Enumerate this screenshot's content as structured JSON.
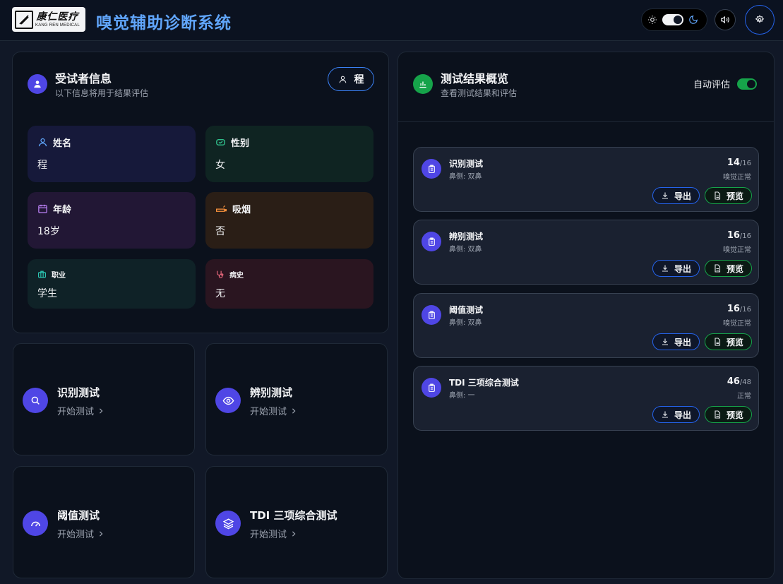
{
  "header": {
    "logo_cn": "康仁医疗",
    "logo_en": "KANG REN MEDICAL",
    "title": "嗅觉辅助诊断系统"
  },
  "subject": {
    "title": "受试者信息",
    "subtitle": "以下信息将用于结果评估",
    "user_name": "程",
    "fields": {
      "name": {
        "label": "姓名",
        "value": "程"
      },
      "gender": {
        "label": "性别",
        "value": "女"
      },
      "age": {
        "label": "年龄",
        "value": "18岁"
      },
      "smoking": {
        "label": "吸烟",
        "value": "否"
      },
      "occupation": {
        "label": "职业",
        "value": "学生"
      },
      "history": {
        "label": "病史",
        "value": "无"
      }
    }
  },
  "tests": [
    {
      "title": "识别测试",
      "action": "开始测试"
    },
    {
      "title": "辨别测试",
      "action": "开始测试"
    },
    {
      "title": "阈值测试",
      "action": "开始测试"
    },
    {
      "title": "TDI 三项综合测试",
      "action": "开始测试"
    }
  ],
  "results": {
    "title": "测试结果概览",
    "subtitle": "查看测试结果和评估",
    "auto_eval_label": "自动评估",
    "auto_eval_on": true,
    "export_label": "导出",
    "preview_label": "预览",
    "items": [
      {
        "title": "识别测试",
        "side": "鼻侧: 双鼻",
        "score": "14",
        "total": "/16",
        "status": "嗅觉正常"
      },
      {
        "title": "辨别测试",
        "side": "鼻侧: 双鼻",
        "score": "16",
        "total": "/16",
        "status": "嗅觉正常"
      },
      {
        "title": "阈值测试",
        "side": "鼻侧: 双鼻",
        "score": "16",
        "total": "/16",
        "status": "嗅觉正常"
      },
      {
        "title": "TDI 三项综合测试",
        "side": "鼻侧: 一",
        "score": "46",
        "total": "/48",
        "status": "正常"
      }
    ]
  },
  "colors": {
    "accent": "#60a5fa",
    "primary": "#4f46e5",
    "success": "#16a34a"
  }
}
